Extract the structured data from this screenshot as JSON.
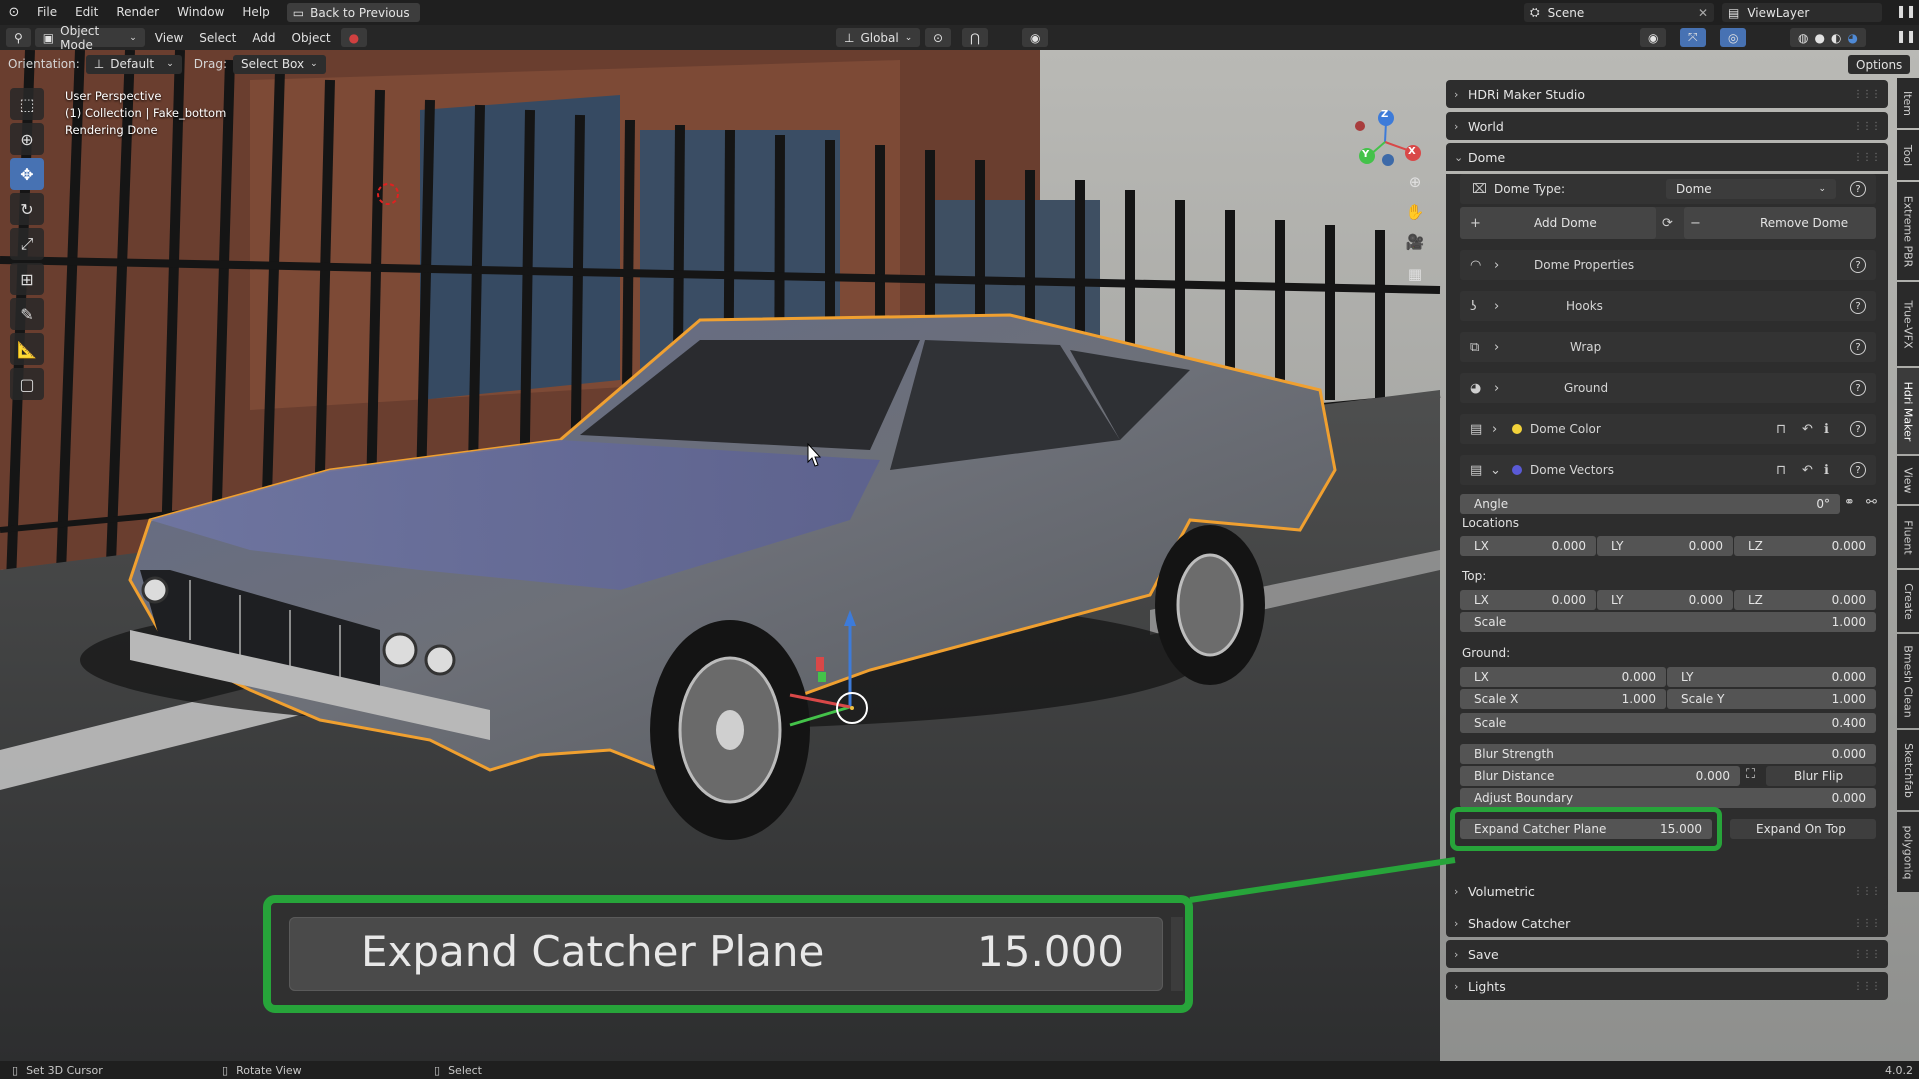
{
  "menubar": {
    "items": [
      "File",
      "Edit",
      "Render",
      "Window",
      "Help"
    ],
    "back_label": "Back to Previous",
    "scene_name": "Scene",
    "view_layer": "ViewLayer"
  },
  "viewport_header": {
    "mode": "Object Mode",
    "menus": [
      "View",
      "Select",
      "Add",
      "Object"
    ],
    "transform_orientation": "Global",
    "options_label": "Options"
  },
  "tool_header": {
    "orientation_label": "Orientation:",
    "orientation_value": "Default",
    "drag_label": "Drag:",
    "drag_value": "Select Box"
  },
  "viewport_info": {
    "line1": "User Perspective",
    "line2": "(1) Collection | Fake_bottom",
    "line3": "Rendering Done"
  },
  "gizmo_axes": {
    "x": "X",
    "y": "Y",
    "z": "Z"
  },
  "npanel": {
    "sections_top": [
      "HDRi Maker Studio",
      "World",
      "Dome"
    ],
    "dome": {
      "dome_type_label": "Dome Type:",
      "dome_type_value": "Dome",
      "add_dome": "Add Dome",
      "remove_dome": "Remove Dome",
      "subpanels": [
        "Dome Properties",
        "Hooks",
        "Wrap",
        "Ground"
      ],
      "dome_color": "Dome Color",
      "dome_vectors": "Dome Vectors",
      "angle_label": "Angle",
      "angle_value": "0°",
      "locations_label": "Locations",
      "lx": "LX",
      "ly": "LY",
      "lz": "LZ",
      "loc_lx": "0.000",
      "loc_ly": "0.000",
      "loc_lz": "0.000",
      "top_label": "Top:",
      "top_lx": "0.000",
      "top_ly": "0.000",
      "top_lz": "0.000",
      "scale_label": "Scale",
      "top_scale": "1.000",
      "ground_label": "Ground:",
      "ground_lx": "0.000",
      "ground_ly": "0.000",
      "scale_x_label": "Scale X",
      "scale_x": "1.000",
      "scale_y_label": "Scale Y",
      "scale_y": "1.000",
      "ground_scale": "0.400",
      "blur_strength_label": "Blur Strength",
      "blur_strength": "0.000",
      "blur_distance_label": "Blur Distance",
      "blur_distance": "0.000",
      "blur_flip_label": "Blur Flip",
      "adjust_boundary_label": "Adjust Boundary",
      "adjust_boundary": "0.000",
      "expand_catcher_label": "Expand Catcher Plane",
      "expand_catcher": "15.000",
      "expand_on_top_label": "Expand On Top"
    },
    "sections_bottom": [
      "Volumetric",
      "Shadow Catcher",
      "Save",
      "Lights"
    ]
  },
  "vertical_tabs": [
    "Item",
    "Tool",
    "Extreme PBR",
    "True-VFX",
    "Hdri Maker",
    "View",
    "Fluent",
    "Create",
    "Bmesh Clean",
    "Sketchfab",
    "polygoniq"
  ],
  "callout": {
    "label": "Expand Catcher Plane",
    "value": "15.000"
  },
  "statusbar": {
    "items": [
      "Set 3D Cursor",
      "Rotate View",
      "Select"
    ],
    "version": "4.0.2"
  },
  "colors": {
    "accent": "#4772b3",
    "highlight_green": "#27a43a",
    "selection_orange": "#f0a030",
    "dome_color_dot": "#f2d23a",
    "dome_vectors_dot": "#5a5ad6"
  }
}
